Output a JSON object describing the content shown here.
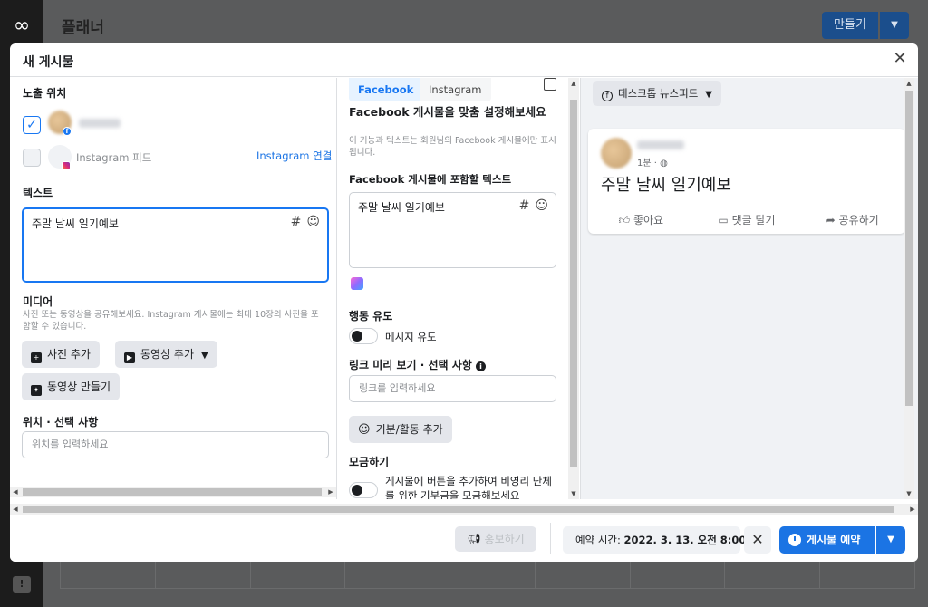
{
  "background": {
    "title": "플래너",
    "create_label": "만들기",
    "sidebar_icon": "meta-logo"
  },
  "modal": {
    "title": "새 게시물",
    "close_icon": "close-icon"
  },
  "left": {
    "placement_label": "노출 위치",
    "instagram_feed_label": "Instagram 피드",
    "instagram_connect": "Instagram 연결",
    "text_label": "텍스트",
    "text_value": "주말 날씨 일기예보",
    "media_label": "미디어",
    "media_desc": "사진 또는 동영상을 공유해보세요. Instagram 게시물에는 최대 10장의 사진을 포함할 수 있습니다.",
    "add_photo": "사진 추가",
    "add_video": "동영상 추가",
    "make_video": "동영상 만들기",
    "location_label": "위치 · 선택 사항",
    "location_placeholder": "위치를 입력하세요"
  },
  "middle": {
    "tab_facebook": "Facebook",
    "tab_instagram": "Instagram",
    "customize_title": "Facebook 게시물을 맞춤 설정해보세요",
    "customize_desc": "이 기능과 텍스트는 회원님의 Facebook 게시물에만 표시됩니다.",
    "include_text_label": "Facebook 게시물에 포함할 텍스트",
    "text_value": "주말 날씨 일기예보",
    "cta_label": "행동 유도",
    "message_cta": "메시지 유도",
    "link_preview_label": "링크 미리 보기 · 선택 사항",
    "link_placeholder": "링크를 입력하세요",
    "feeling_button": "기분/활동 추가",
    "fundraise_label": "모금하기",
    "fundraise_desc": "게시물에 버튼을 추가하여 비영리 단체를 위한 기부금을 모금해보세요"
  },
  "right": {
    "preview_dropdown": "데스크톱 뉴스피드",
    "post_time": "1분 ·",
    "post_text": "주말 날씨 일기예보",
    "like": "좋아요",
    "comment": "댓글 달기",
    "share": "공유하기"
  },
  "footer": {
    "boost": "홍보하기",
    "schedule_prefix": "예약 시간:",
    "schedule_value": "2022. 3. 13. 오전 8:00",
    "schedule_post": "게시물 예약"
  }
}
